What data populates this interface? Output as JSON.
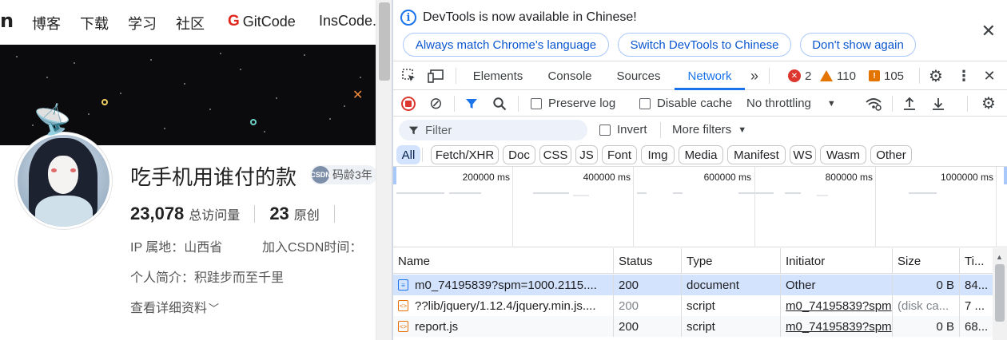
{
  "csdn": {
    "nav": {
      "logo_tail": "n",
      "items": [
        "博客",
        "下载",
        "学习",
        "社区"
      ],
      "gitcode": "GitCode",
      "inscode": "InsCode.AI"
    },
    "profile": {
      "username": "吃手机用谁付的款",
      "badge": "码龄3年",
      "badge_icon_text": "CSDN",
      "visits_value": "23,078",
      "visits_label": "总访问量",
      "original_value": "23",
      "original_label": "原创",
      "ip_label": "IP 属地：山西省",
      "join_label": "加入CSDN时间：",
      "bio": "个人简介：积跬步而至千里",
      "more": "查看详细资料"
    }
  },
  "devtools": {
    "infobar": {
      "message": "DevTools is now available in Chinese!",
      "buttons": [
        "Always match Chrome's language",
        "Switch DevTools to Chinese",
        "Don't show again"
      ]
    },
    "tabs": [
      "Elements",
      "Console",
      "Sources",
      "Network"
    ],
    "active_tab": "Network",
    "counts": {
      "errors": "2",
      "warnings": "110",
      "issues": "105"
    },
    "toolbar": {
      "preserve_log": "Preserve log",
      "disable_cache": "Disable cache",
      "throttling": "No throttling"
    },
    "filter": {
      "placeholder": "Filter",
      "invert": "Invert",
      "more_filters": "More filters"
    },
    "types": [
      "All",
      "Fetch/XHR",
      "Doc",
      "CSS",
      "JS",
      "Font",
      "Img",
      "Media",
      "Manifest",
      "WS",
      "Wasm",
      "Other"
    ],
    "active_type": "All",
    "timeline_ticks": [
      "200000 ms",
      "400000 ms",
      "600000 ms",
      "800000 ms",
      "1000000 ms"
    ],
    "columns": [
      "Name",
      "Status",
      "Type",
      "Initiator",
      "Size",
      "Ti..."
    ],
    "rows": [
      {
        "name": "m0_74195839?spm=1000.2115....",
        "status": "200",
        "type": "document",
        "initiator": "Other",
        "size": "0 B",
        "time": "84..."
      },
      {
        "name": "??lib/jquery/1.12.4/jquery.min.js....",
        "status": "200",
        "type": "script",
        "initiator": "m0_74195839?spm",
        "size": "(disk ca...",
        "time": "7 ..."
      },
      {
        "name": "report.js",
        "status": "200",
        "type": "script",
        "initiator": "m0_74195839?spm",
        "size": "0 B",
        "time": "68..."
      }
    ]
  }
}
